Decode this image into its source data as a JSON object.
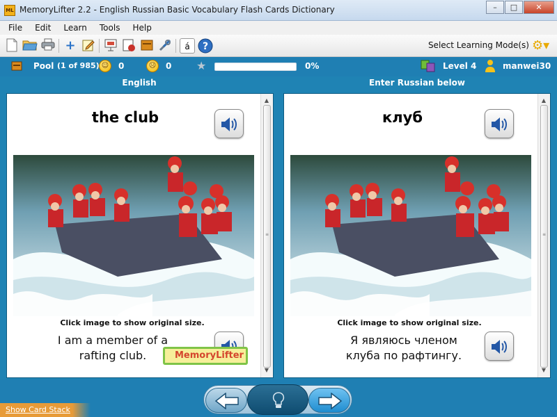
{
  "window": {
    "title": "MemoryLifter 2.2 - English Russian Basic Vocabulary Flash Cards Dictionary",
    "app_icon_label": "ML"
  },
  "menu": [
    "File",
    "Edit",
    "Learn",
    "Tools",
    "Help"
  ],
  "toolbar": {
    "buttons": [
      "new-document",
      "open-folder",
      "print",
      "add",
      "edit",
      "slideshow",
      "statistics",
      "box",
      "settings",
      "special-chars",
      "help"
    ],
    "special_char_label": "á",
    "mode_label": "Select Learning Mode(s)"
  },
  "status": {
    "pool_label": "Pool",
    "pool_count": "(1 of 985)",
    "correct_count": "0",
    "wrong_count": "0",
    "progress_percent": 0,
    "progress_label": "0%",
    "level": "Level 4",
    "user": "manwei30"
  },
  "panels": {
    "left": {
      "header": "English",
      "word": "the club",
      "caption": "Click image to show original size.",
      "example_line1": "I am a member of a",
      "example_line2": "rafting club.",
      "watermark": "MemoryLifter"
    },
    "right": {
      "header": "Enter Russian below",
      "word": "клуб",
      "caption": "Click image to show original size.",
      "example_line1": "Я являюсь членом",
      "example_line2": "клуба по рафтингу."
    }
  },
  "bottom": {
    "show_card_stack": "Show Card Stack"
  },
  "colors": {
    "accent": "#1f7fb3",
    "stack_tab": "#e79b38"
  }
}
